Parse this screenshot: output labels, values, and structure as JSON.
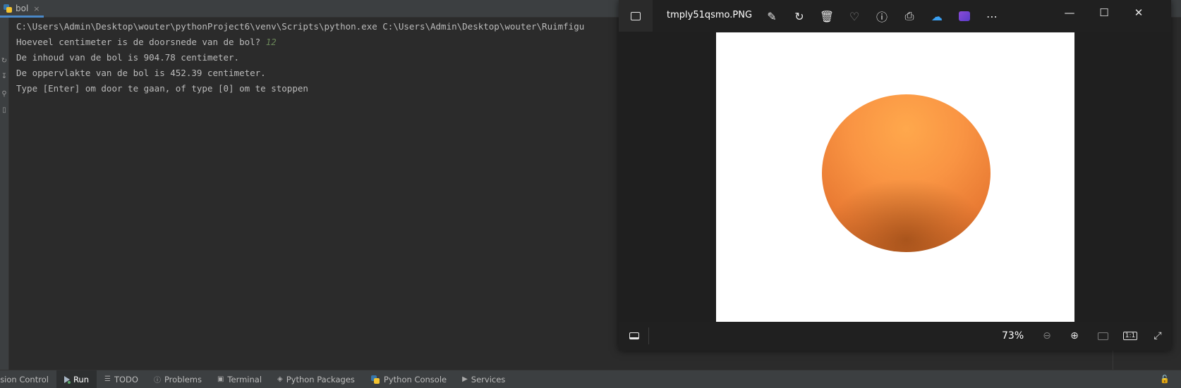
{
  "ide": {
    "tab": {
      "label": "bol",
      "close": "×"
    },
    "console_lines": [
      {
        "text": "C:\\Users\\Admin\\Desktop\\wouter\\pythonProject6\\venv\\Scripts\\python.exe C:\\Users\\Admin\\Desktop\\wouter\\Ruimfigu"
      },
      {
        "text": "Hoeveel centimeter is de doorsnede van de bol? ",
        "input": "12"
      },
      {
        "text": "De inhoud van de bol is 904.78 centimeter."
      },
      {
        "text": "De oppervlakte van de bol is 452.39 centimeter."
      },
      {
        "text": "Type [Enter] om door te gaan, of type [0] om te stoppen"
      }
    ],
    "tool_tabs": [
      {
        "label": "ision Control",
        "icon": "version-control-icon"
      },
      {
        "label": "Run",
        "icon": "run-icon"
      },
      {
        "label": "TODO",
        "icon": "todo-icon"
      },
      {
        "label": "Problems",
        "icon": "problems-icon"
      },
      {
        "label": "Terminal",
        "icon": "terminal-icon"
      },
      {
        "label": "Python Packages",
        "icon": "packages-icon"
      },
      {
        "label": "Python Console",
        "icon": "python-console-icon"
      },
      {
        "label": "Services",
        "icon": "services-icon"
      }
    ],
    "colors": {
      "accent": "#4a88c7",
      "input": "#6a8759",
      "background": "#2b2b2b"
    }
  },
  "photo_viewer": {
    "filename": "tmply51qsmo.PNG",
    "zoom": "73%",
    "toolbar_icons": [
      "edit-image-icon",
      "rotate-icon",
      "delete-icon",
      "favorite-icon",
      "info-icon",
      "print-icon",
      "onedrive-icon",
      "video-editor-icon",
      "more-icon"
    ],
    "image_colors": {
      "sphere": "#f99443",
      "sphere_shadow": "#c86426"
    }
  }
}
